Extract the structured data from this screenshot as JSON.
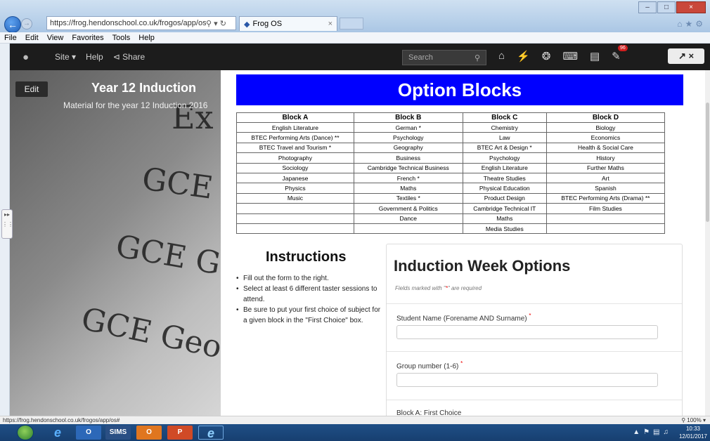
{
  "browser": {
    "url": "https://frog.hendonschool.co.uk/frogos/app/os#",
    "tab_title": "Frog OS",
    "menu": [
      "File",
      "Edit",
      "View",
      "Favorites",
      "Tools",
      "Help"
    ]
  },
  "frogbar": {
    "site_label": "Site",
    "help_label": "Help",
    "share_label": "Share",
    "search_placeholder": "Search",
    "notification_count": "96"
  },
  "sidebar": {
    "edit_label": "Edit",
    "title": "Year 12 Induction",
    "subtitle": "Material for the year 12 Induction 2016",
    "background_words": [
      "GCE",
      "GCE Ge",
      "GCE Geog",
      "Ex"
    ]
  },
  "option_blocks": {
    "banner": "Option Blocks",
    "headers": [
      "Block A",
      "Block B",
      "Block C",
      "Block D"
    ],
    "rows": [
      [
        "English Literature",
        "German *",
        "Chemistry",
        "Biology"
      ],
      [
        "BTEC Performing Arts (Dance) **",
        "Psychology",
        "Law",
        "Economics"
      ],
      [
        "BTEC Travel and Tourism *",
        "Geography",
        "BTEC Art & Design *",
        "Health & Social Care"
      ],
      [
        "Photography",
        "Business",
        "Psychology",
        "History"
      ],
      [
        "Sociology",
        "Cambridge Technical Business",
        "English Literature",
        "Further Maths"
      ],
      [
        "Japanese",
        "French *",
        "Theatre Studies",
        "Art"
      ],
      [
        "Physics",
        "Maths",
        "Physical Education",
        "Spanish"
      ],
      [
        "Music",
        "Textiles *",
        "Product Design",
        "BTEC Performing Arts (Drama) **"
      ],
      [
        "",
        "Government & Politics",
        "Cambridge Technical IT",
        "Film Studies"
      ],
      [
        "",
        "Dance",
        "Maths",
        ""
      ],
      [
        "",
        "",
        "Media Studies",
        ""
      ]
    ]
  },
  "instructions": {
    "title": "Instructions",
    "items": [
      "Fill out the form to the right.",
      "Select at least 6 different taster sessions to attend.",
      "Be sure to put your first choice of subject for a given block in the \"First Choice\" box."
    ]
  },
  "form": {
    "title": "Induction Week Options",
    "required_note_pre": "Fields marked with \"",
    "required_note_star": "*",
    "required_note_post": "\" are required",
    "fields": [
      {
        "label": "Student Name (Forename AND Surname)",
        "required": "*"
      },
      {
        "label": "Group number (1-6)",
        "required": "*"
      },
      {
        "label": "Block A: First Choice"
      }
    ]
  },
  "statusbar": {
    "url": "https://frog.hendonschool.co.uk/frogos/app/os#",
    "zoom": "100%"
  },
  "taskbar": {
    "sims_label": "SIMS",
    "time": "10:33",
    "date": "12/01/2017"
  }
}
